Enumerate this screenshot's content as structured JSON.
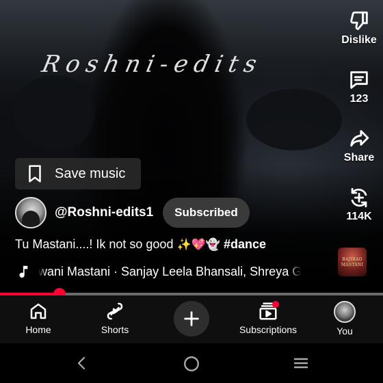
{
  "video": {
    "watermark": "Roshni-edits"
  },
  "actions": {
    "dislike_label": "Dislike",
    "comments_count": "123",
    "share_label": "Share",
    "remix_count": "114K"
  },
  "save_music": {
    "label": "Save music"
  },
  "channel": {
    "handle": "@Roshni-edits1",
    "subscribe_state": "Subscribed"
  },
  "caption": {
    "text": "Tu Mastani....! Ik not so good",
    "emojis": "✨💖👻",
    "hashtag": "#dance"
  },
  "music": {
    "track": "wani Mastani · Sanjay Leela Bhansali, Shreya G",
    "album_art_text": [
      "BAJIRAO",
      "MASTANI"
    ]
  },
  "progress": {
    "played_fraction": 0.155
  },
  "nav": {
    "items": [
      {
        "label": "Home",
        "icon": "home-icon"
      },
      {
        "label": "Shorts",
        "icon": "shorts-icon"
      },
      {
        "label": "",
        "icon": "create-plus-icon"
      },
      {
        "label": "Subscriptions",
        "icon": "subscriptions-icon"
      },
      {
        "label": "You",
        "icon": "profile-avatar"
      }
    ],
    "notification_dot_color": "#ff0033"
  },
  "colors": {
    "accent": "#ff0033",
    "chip_bg": "#3a3a3a"
  }
}
